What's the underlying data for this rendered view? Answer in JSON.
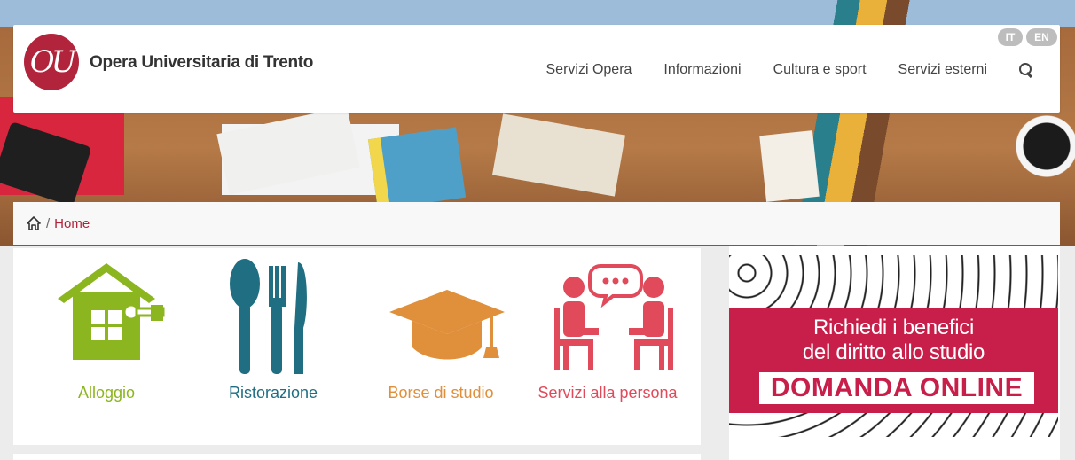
{
  "header": {
    "logo_letters": "OU",
    "site_name": "Opera Universitaria di Trento",
    "languages": [
      "IT",
      "EN"
    ],
    "nav": [
      "Servizi Opera",
      "Informazioni",
      "Cultura e sport",
      "Servizi esterni"
    ],
    "search_icon": "search-icon"
  },
  "breadcrumb": {
    "separator": "/",
    "current": "Home"
  },
  "services": [
    {
      "label": "Alloggio",
      "icon": "house-key-icon",
      "color": "#8cb61f"
    },
    {
      "label": "Ristorazione",
      "icon": "cutlery-icon",
      "color": "#1f6e82"
    },
    {
      "label": "Borse di studio",
      "icon": "graduation-cap-icon",
      "color": "#e08f3a"
    },
    {
      "label": "Servizi alla persona",
      "icon": "people-talking-icon",
      "color": "#e04a5b"
    }
  ],
  "banner": {
    "line1": "Richiedi i benefici",
    "line2": "del diritto allo studio",
    "cta": "DOMANDA ONLINE",
    "accent": "#c81e4a"
  },
  "colors": {
    "brand": "#b2243b",
    "lang_badge": "#bdbdbd"
  }
}
